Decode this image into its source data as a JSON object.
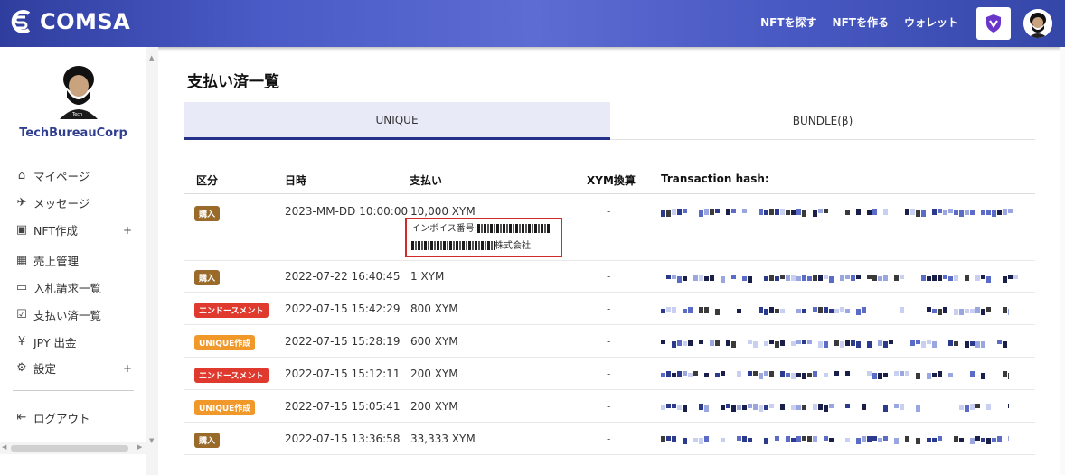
{
  "header": {
    "logo_text": "COMSA",
    "nav": [
      "NFTを探す",
      "NFTを作る",
      "ウォレット"
    ]
  },
  "sidebar": {
    "username": "TechBureauCorp",
    "items": [
      {
        "label": "マイページ",
        "icon": "home-icon"
      },
      {
        "label": "メッセージ",
        "icon": "send-icon"
      },
      {
        "label": "NFT作成",
        "icon": "image-icon",
        "plus": "+"
      },
      {
        "label": "売上管理",
        "icon": "calculator-icon"
      },
      {
        "label": "入札請求一覧",
        "icon": "yen-card-icon"
      },
      {
        "label": "支払い済一覧",
        "icon": "check-box-icon"
      },
      {
        "label": "JPY 出金",
        "icon": "yen-icon"
      },
      {
        "label": "設定",
        "icon": "gear-icon",
        "plus": "+"
      }
    ],
    "logout": "ログアウト"
  },
  "main": {
    "title": "支払い済一覧",
    "tabs": [
      {
        "label": "UNIQUE",
        "active": true
      },
      {
        "label": "BUNDLE(β)",
        "active": false
      }
    ],
    "columns": [
      "区分",
      "日時",
      "支払い",
      "XYM換算",
      "Transaction hash:"
    ],
    "rows": [
      {
        "type": "購入",
        "color": "#9a6a2b",
        "date": "2023-MM-DD 10:00:00",
        "amount": "10,000 XYM",
        "xym": "-",
        "invoice_label": "インボイス番号:",
        "company_suffix": "株式会社"
      },
      {
        "type": "購入",
        "color": "#9a6a2b",
        "date": "2022-07-22 16:40:45",
        "amount": "1 XYM",
        "xym": "-"
      },
      {
        "type": "エンドースメント",
        "color": "#e03a2e",
        "date": "2022-07-15 15:42:29",
        "amount": "800 XYM",
        "xym": "-"
      },
      {
        "type": "UNIQUE作成",
        "color": "#f0982a",
        "date": "2022-07-15 15:28:19",
        "amount": "600 XYM",
        "xym": "-"
      },
      {
        "type": "エンドースメント",
        "color": "#e03a2e",
        "date": "2022-07-15 15:12:11",
        "amount": "200 XYM",
        "xym": "-"
      },
      {
        "type": "UNIQUE作成",
        "color": "#f0982a",
        "date": "2022-07-15 15:05:41",
        "amount": "200 XYM",
        "xym": "-"
      },
      {
        "type": "購入",
        "color": "#9a6a2b",
        "date": "2022-07-15 13:36:58",
        "amount": "33,333 XYM",
        "xym": "-"
      }
    ]
  }
}
